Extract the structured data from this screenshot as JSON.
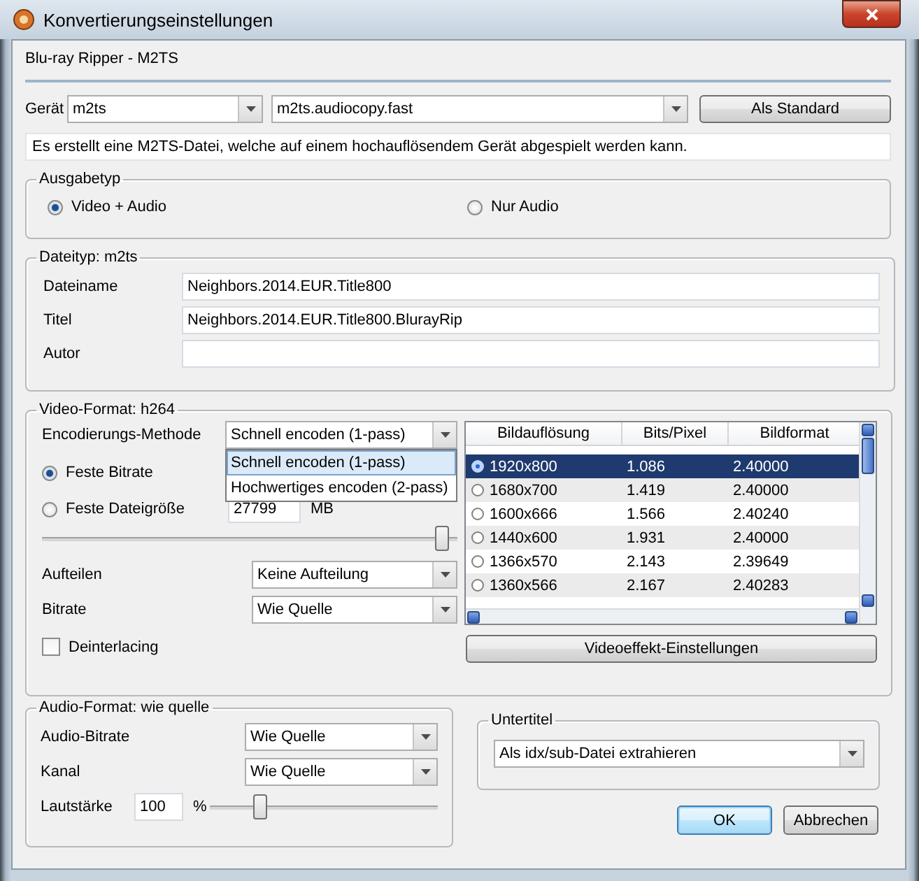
{
  "window": {
    "title": "Konvertierungseinstellungen"
  },
  "header": {
    "title": "Blu-ray Ripper - M2TS"
  },
  "device": {
    "label": "Gerät",
    "device_value": "m2ts",
    "profile_value": "m2ts.audiocopy.fast",
    "default_button": "Als Standard"
  },
  "description": "Es erstellt eine M2TS-Datei, welche auf einem hochauflösendem Gerät abgespielt werden kann.",
  "output_type": {
    "title": "Ausgabetyp",
    "options": [
      {
        "label": "Video + Audio",
        "selected": true
      },
      {
        "label": "Nur Audio",
        "selected": false
      }
    ]
  },
  "file_type": {
    "title": "Dateityp: m2ts",
    "fields": [
      {
        "label": "Dateiname",
        "value": "Neighbors.2014.EUR.Title800"
      },
      {
        "label": "Titel",
        "value": "Neighbors.2014.EUR.Title800.BlurayRip"
      },
      {
        "label": "Autor"
      }
    ]
  },
  "video_format": {
    "title": "Video-Format: h264",
    "encoding": {
      "label": "Encodierungs-Methode",
      "value": "Schnell encoden (1-pass)",
      "expanded": true,
      "options": [
        {
          "label": "Schnell encoden (1-pass)",
          "selected": true
        },
        {
          "label": "Hochwertiges encoden (2-pass)",
          "selected": false
        }
      ]
    },
    "bitrate_modes": [
      {
        "label": "Feste Bitrate",
        "selected": true
      },
      {
        "label": "Feste Dateigröße",
        "selected": false
      }
    ],
    "file_size": {
      "value": "27799",
      "unit": "MB"
    },
    "quality_slider": {
      "level": 0.98
    },
    "split": {
      "label": "Aufteilen",
      "value": "Keine Aufteilung"
    },
    "bitrate": {
      "label": "Bitrate",
      "value": "Wie Quelle"
    },
    "deinterlacing": {
      "label": "Deinterlacing",
      "checked": false
    },
    "resolutions": {
      "columns": [
        "Bildauflösung",
        "Bits/Pixel",
        "Bildformat"
      ],
      "rows": [
        {
          "cells": [
            "1920x800",
            "1.086",
            "2.40000"
          ],
          "selected": true
        },
        {
          "cells": [
            "1680x700",
            "1.419",
            "2.40000"
          ],
          "selected": false
        },
        {
          "cells": [
            "1600x666",
            "1.566",
            "2.40240"
          ],
          "selected": false
        },
        {
          "cells": [
            "1440x600",
            "1.931",
            "2.40000"
          ],
          "selected": false
        },
        {
          "cells": [
            "1366x570",
            "2.143",
            "2.39649"
          ],
          "selected": false
        },
        {
          "cells": [
            "1360x566",
            "2.167",
            "2.40283"
          ],
          "selected": false
        }
      ]
    },
    "effects_button": "Videoeffekt-Einstellungen"
  },
  "audio_format": {
    "title": "Audio-Format: wie quelle",
    "bitrate": {
      "label": "Audio-Bitrate",
      "value": "Wie Quelle"
    },
    "channel": {
      "label": "Kanal",
      "value": "Wie Quelle"
    },
    "volume": {
      "label": "Lautstärke",
      "value": "100",
      "unit": "%",
      "level": 0.2
    }
  },
  "subtitles": {
    "title": "Untertitel",
    "value": "Als idx/sub-Datei extrahieren"
  },
  "buttons": [
    {
      "label": "OK",
      "default": true
    },
    {
      "label": "Abbrechen",
      "default": false
    }
  ]
}
